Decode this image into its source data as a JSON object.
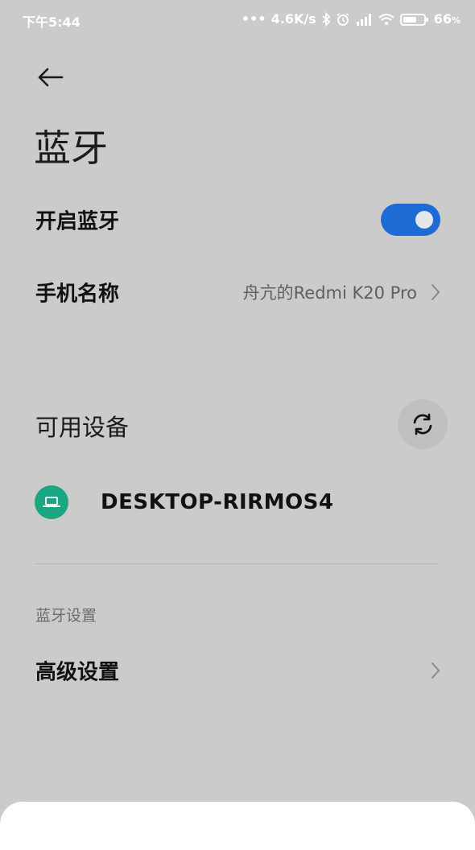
{
  "status_bar": {
    "time": "下午5:44",
    "speed": "4.6K/s",
    "battery": "66",
    "battery_unit": "%",
    "battery_level": 0.66
  },
  "header": {
    "title": "蓝牙"
  },
  "settings": {
    "bluetooth_toggle": {
      "label": "开启蓝牙",
      "enabled": true
    },
    "device_name": {
      "label": "手机名称",
      "value": "舟亢的Redmi K20 Pro"
    }
  },
  "available_devices": {
    "heading": "可用设备",
    "devices": [
      {
        "name": "DESKTOP-RIRMOS4",
        "icon": "laptop-icon"
      }
    ]
  },
  "bluetooth_settings": {
    "group_label": "蓝牙设置",
    "advanced_label": "高级设置"
  },
  "colors": {
    "accent": "#1f6bd6",
    "device_icon_bg": "#1aa583",
    "background": "#cbcbcb"
  }
}
